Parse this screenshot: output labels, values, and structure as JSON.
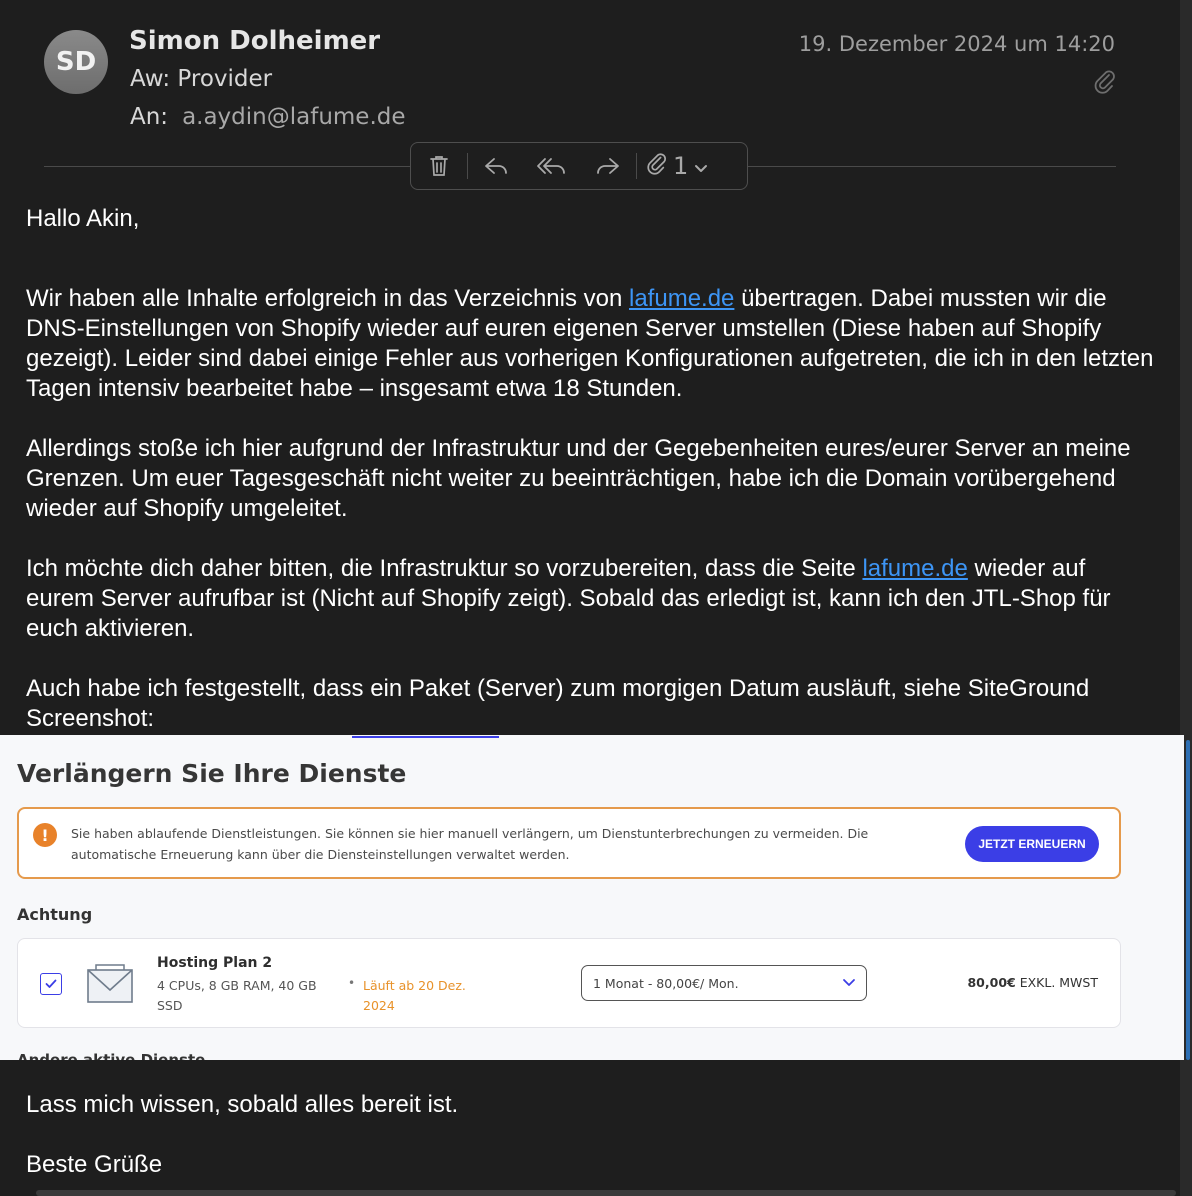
{
  "header": {
    "avatar_initials": "SD",
    "sender_name": "Simon Dolheimer",
    "subject": "Aw: Provider",
    "to_label": "An:",
    "to_address": "a.aydin@lafume.de",
    "date": "19. Dezember 2024 um 14:20",
    "has_attachment_icon": "paperclip-icon"
  },
  "toolbar": {
    "icons": [
      "trash-icon",
      "reply-icon",
      "reply-all-icon",
      "forward-icon",
      "paperclip-icon",
      "chevron-down-icon"
    ],
    "attachment_count": "1"
  },
  "body": {
    "greeting": "Hallo Akin,",
    "p1_part1": "Wir haben alle Inhalte erfolgreich in das Verzeichnis von ",
    "p1_link": "lafume.de",
    "p1_part2": " übertragen. Dabei mussten wir die DNS-Einstellungen von Shopify wieder auf euren eigenen Server umstellen (Diese haben auf Shopify gezeigt). Leider sind dabei einige Fehler aus vorherigen Konfigurationen aufgetreten, die ich in den letzten Tagen intensiv bearbeitet habe – insgesamt etwa 18 Stunden.",
    "p2": "Allerdings stoße ich hier aufgrund der Infrastruktur und der Gegebenheiten eures/eurer Server an meine Grenzen. Um euer Tagesgeschäft nicht weiter zu beeinträchtigen, habe ich die Domain vorübergehend wieder auf Shopify umgeleitet.",
    "p3_part1": "Ich möchte dich daher bitten, die Infrastruktur so vorzubereiten, dass die Seite ",
    "p3_link": "lafume.de",
    "p3_part2": " wieder auf eurem Server aufrufbar ist (Nicht auf Shopify zeigt). Sobald das erledigt ist, kann ich den JTL-Shop für euch aktivieren.",
    "p4": "Auch habe ich festgestellt, dass ein Paket (Server) zum morgigen Datum ausläuft, siehe SiteGround Screenshot:",
    "closing1": "Lass mich wissen, sobald alles bereit ist.",
    "closing2": "Beste Grüße"
  },
  "screenshot": {
    "title": "Verlängern Sie Ihre Dienste",
    "alert_text": "Sie haben ablaufende Dienstleistungen. Sie können sie hier manuell verlängern, um Dienstunterbrechungen zu vermeiden. Die automatische Erneuerung kann über die Diensteinstellungen verwaltet werden.",
    "alert_icon": "!",
    "renew_button": "JETZT ERNEUERN",
    "section_label": "Achtung",
    "service": {
      "name": "Hosting Plan 2",
      "specs": "4 CPUs, 8 GB RAM, 40 GB SSD",
      "bullet": "•",
      "expiry": "Läuft ab 20 Dez. 2024",
      "plan_select": "1 Monat - 80,00€/ Mon.",
      "price_amount": "80,00€",
      "price_suffix": " EXKL. MWST"
    },
    "cut_label": "Andere aktive Dienste"
  },
  "colors": {
    "background": "#1e1e1e",
    "link": "#3d95f5",
    "accent_button": "#3b3ee6",
    "warning_orange": "#e8822a"
  }
}
